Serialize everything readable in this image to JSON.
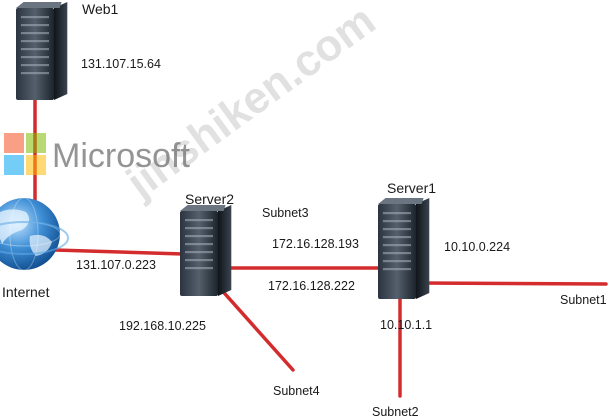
{
  "colors": {
    "link": "#d42c2c",
    "ms_red": "#f25022",
    "ms_green": "#7fba00",
    "ms_blue": "#00a4ef",
    "ms_yellow": "#ffb900"
  },
  "nodes": {
    "web1": {
      "label": "Web1",
      "icon": "server-tower-icon"
    },
    "server2": {
      "label": "Server2",
      "icon": "server-tower-icon"
    },
    "server1": {
      "label": "Server1",
      "icon": "server-tower-icon"
    },
    "internet": {
      "label": "Internet",
      "icon": "globe-icon"
    }
  },
  "addresses": {
    "web1": "131.107.15.64",
    "server2_internet": "131.107.0.223",
    "server2_subnet3": "172.16.128.193",
    "server2_subnet4": "192.168.10.225",
    "server1_subnet3": "172.16.128.222",
    "server1_subnet1": "10.10.0.224",
    "server1_subnet2": "10.10.1.1"
  },
  "subnets": {
    "subnet1": "Subnet1",
    "subnet2": "Subnet2",
    "subnet3": "Subnet3",
    "subnet4": "Subnet4"
  },
  "branding": {
    "logo_text": "Microsoft",
    "watermark": "jinshiken.com"
  }
}
